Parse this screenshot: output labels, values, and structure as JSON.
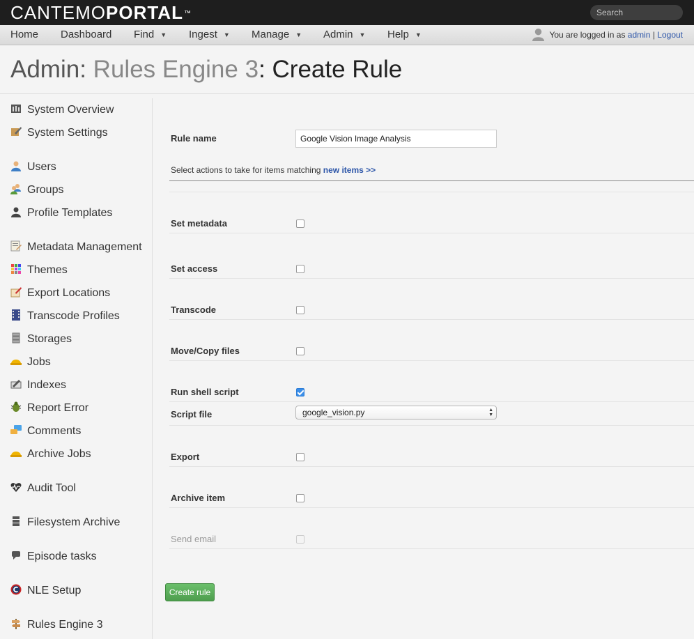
{
  "brand": {
    "logo_thin": "CANTEMO",
    "logo_bold": "PORTAL",
    "logo_tm": "™"
  },
  "search": {
    "placeholder": "Search"
  },
  "nav": {
    "items": [
      {
        "label": "Home",
        "caret": ""
      },
      {
        "label": "Dashboard",
        "caret": ""
      },
      {
        "label": "Find",
        "caret": "▼"
      },
      {
        "label": "Ingest",
        "caret": "▼"
      },
      {
        "label": "Manage",
        "caret": "▼"
      },
      {
        "label": "Admin",
        "caret": "▼"
      },
      {
        "label": "Help",
        "caret": "▼"
      }
    ],
    "user_prefix": "You are logged in as",
    "username": "admin",
    "separator": "|",
    "logout": "Logout"
  },
  "page": {
    "title_prefix": "Admin:",
    "title_crumb": "Rules Engine 3",
    "title_current": ": Create Rule"
  },
  "sidebar": {
    "items": [
      {
        "label": "System Overview",
        "icon": "system-overview-icon"
      },
      {
        "label": "System Settings",
        "icon": "system-settings-icon"
      },
      {
        "label": "Users",
        "icon": "user-icon"
      },
      {
        "label": "Groups",
        "icon": "group-icon"
      },
      {
        "label": "Profile Templates",
        "icon": "profile-icon"
      },
      {
        "label": "Metadata Management",
        "icon": "metadata-icon"
      },
      {
        "label": "Themes",
        "icon": "themes-icon"
      },
      {
        "label": "Export Locations",
        "icon": "export-icon"
      },
      {
        "label": "Transcode Profiles",
        "icon": "film-icon"
      },
      {
        "label": "Storages",
        "icon": "storage-icon"
      },
      {
        "label": "Jobs",
        "icon": "hardhat-icon"
      },
      {
        "label": "Indexes",
        "icon": "index-icon"
      },
      {
        "label": "Report Error",
        "icon": "bug-icon"
      },
      {
        "label": "Comments",
        "icon": "comments-icon"
      },
      {
        "label": "Archive Jobs",
        "icon": "hardhat-icon"
      },
      {
        "label": "Audit Tool",
        "icon": "heartbeat-icon"
      },
      {
        "label": "Filesystem Archive",
        "icon": "archive-icon"
      },
      {
        "label": "Episode tasks",
        "icon": "speech-bubble-icon"
      },
      {
        "label": "NLE Setup",
        "icon": "nle-icon"
      },
      {
        "label": "Rules Engine 3",
        "icon": "signpost-icon"
      }
    ]
  },
  "form": {
    "rule_name_label": "Rule name",
    "rule_name_value": "Google Vision Image Analysis",
    "hint_text": "Select actions to take for items matching",
    "hint_link": "new items >>",
    "actions": [
      {
        "label": "Set metadata",
        "checked": false,
        "disabled": false
      },
      {
        "label": "Set access",
        "checked": false,
        "disabled": false
      },
      {
        "label": "Transcode",
        "checked": false,
        "disabled": false
      },
      {
        "label": "Move/Copy files",
        "checked": false,
        "disabled": false
      },
      {
        "label": "Run shell script",
        "checked": true,
        "disabled": false
      },
      {
        "label": "Export",
        "checked": false,
        "disabled": false
      },
      {
        "label": "Archive item",
        "checked": false,
        "disabled": false
      },
      {
        "label": "Send email",
        "checked": false,
        "disabled": true
      }
    ],
    "script_file_label": "Script file",
    "script_file_value": "google_vision.py",
    "submit_label": "Create rule"
  },
  "colors": {
    "topbar": "#1e1e1e",
    "link": "#2c55a8",
    "submit": "#5aad5a",
    "checkbox_checked": "#3b8ee8"
  }
}
